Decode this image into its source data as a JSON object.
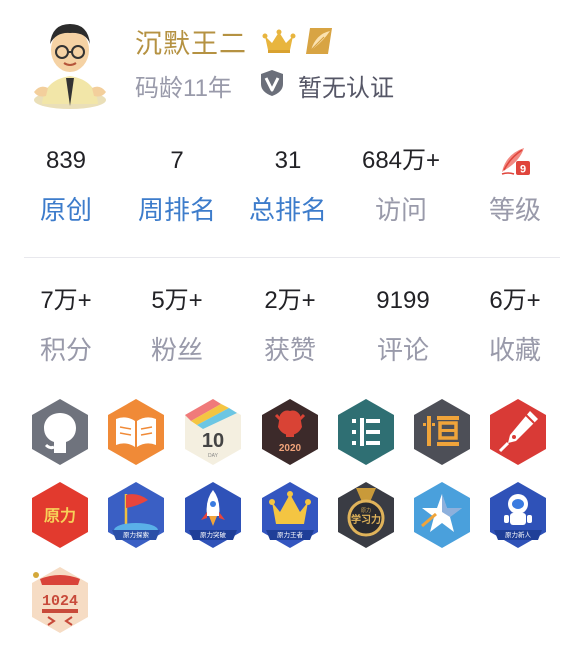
{
  "profile": {
    "name": "沉默王二",
    "coding_age": "码龄11年",
    "certification": "暂无认证"
  },
  "stats_row1": [
    {
      "value": "839",
      "label": "原创"
    },
    {
      "value": "7",
      "label": "周排名"
    },
    {
      "value": "31",
      "label": "总排名"
    },
    {
      "value": "684万+",
      "label": "访问"
    },
    {
      "value": "",
      "label": "等级"
    }
  ],
  "stats_row2": [
    {
      "value": "7万+",
      "label": "积分"
    },
    {
      "value": "5万+",
      "label": "粉丝"
    },
    {
      "value": "2万+",
      "label": "获赞"
    },
    {
      "value": "9199",
      "label": "评论"
    },
    {
      "value": "6万+",
      "label": "收藏"
    }
  ],
  "badges": {
    "calendar_num": "10",
    "calendar_sub": "DAY",
    "year": "2020",
    "original_power": "原力",
    "explorer": "原力探索",
    "breakthrough": "原力突破",
    "king": "原力王者",
    "learn_small": "原力",
    "learn": "学习力",
    "newcomer": "原力新人",
    "code_1024": "1024"
  },
  "colors": {
    "name_gold": "#b59242",
    "link_blue": "#3d7ccb",
    "muted": "#999aaa"
  }
}
